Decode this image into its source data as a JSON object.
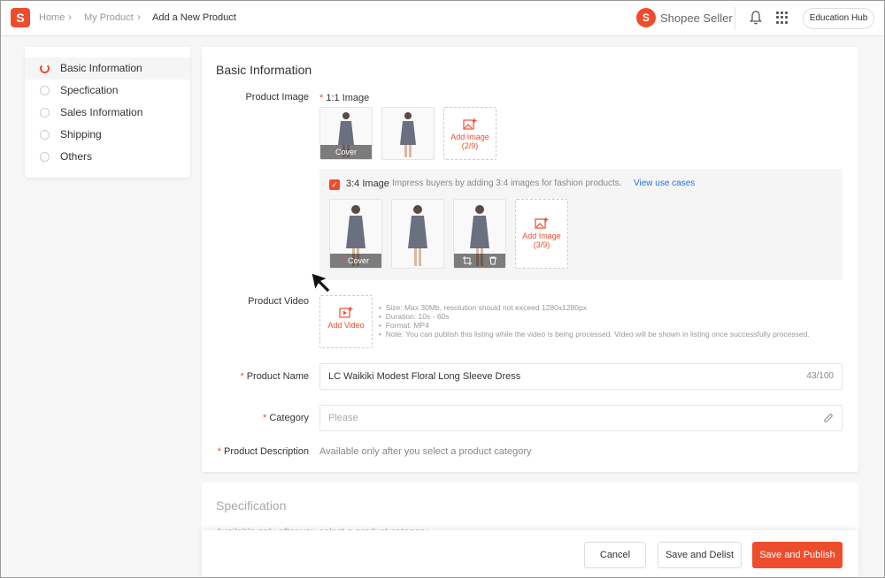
{
  "header": {
    "breadcrumb": [
      "Home",
      "My Product",
      "Add a New Product"
    ],
    "brand": "Shopee Seller",
    "education_hub": "Education Hub",
    "logo_letter": "S"
  },
  "sidebar": {
    "items": [
      {
        "label": "Basic Information",
        "active": true
      },
      {
        "label": "Specfication",
        "active": false
      },
      {
        "label": "Sales Information",
        "active": false
      },
      {
        "label": "Shipping",
        "active": false
      },
      {
        "label": "Others",
        "active": false
      }
    ]
  },
  "basic": {
    "title": "Basic Information",
    "product_image_label": "Product Image",
    "ratio_11_label": "1:1 Image",
    "cover_label": "Cover",
    "add_image_label": "Add Image",
    "add_image_count_11": "(2/9)",
    "ratio_34_label": "3:4 Image",
    "ratio_34_hint": "Impress buyers by adding 3:4 images for fashion products.",
    "view_use_cases": "View use cases",
    "add_image_count_34": "(3/9)",
    "product_video_label": "Product Video",
    "add_video_label": "Add Video",
    "video_notes": [
      "Size: Max 30Mb, resolution should not exceed 1280x1280px",
      "Duration: 10s - 60s",
      "Format: MP4",
      "Note: You can publish this listing while the video is being processed. Video will be shown in listing once successfully processed."
    ],
    "product_name_label": "Product Name",
    "product_name_value": "LC Waikiki Modest Floral Long Sleeve Dress",
    "product_name_counter": "43/100",
    "category_label": "Category",
    "category_placeholder": "Please",
    "description_label": "Product Description",
    "description_note": "Available only after you select a product category"
  },
  "spec": {
    "title": "Specification",
    "note": "Available only after you select a product category"
  },
  "footer": {
    "cancel": "Cancel",
    "save_delist": "Save and Delist",
    "save_publish": "Save and Publish"
  },
  "colors": {
    "accent": "#ee4d2d",
    "link": "#2673dd",
    "dress": "#6b7080"
  }
}
